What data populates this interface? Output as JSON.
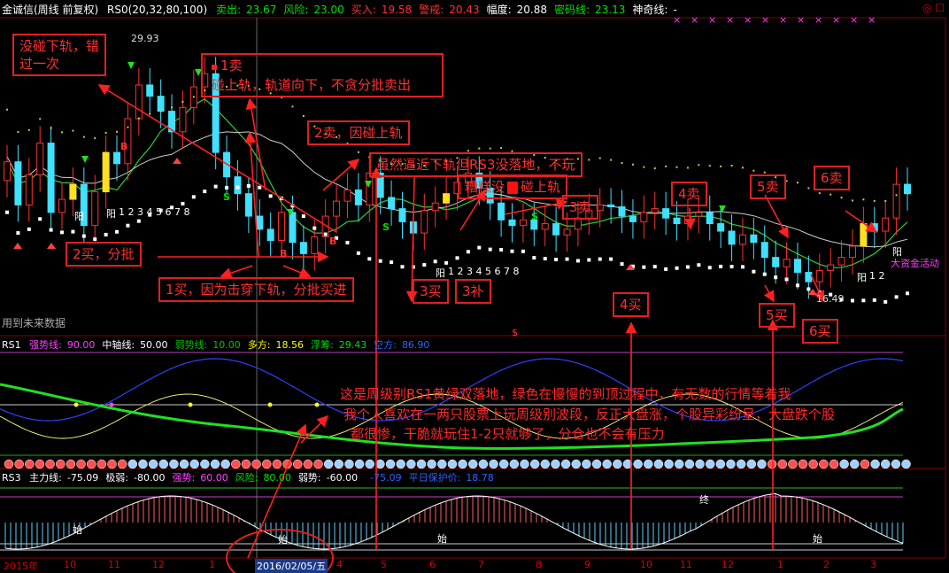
{
  "header": {
    "title": "金诚信(周线 前复权)",
    "rs0_params": "RS0(20,32,80,100)",
    "items": [
      {
        "label": "卖出:",
        "value": "23.67",
        "color": "#00e000"
      },
      {
        "label": "风险:",
        "value": "23.00",
        "color": "#00e000"
      },
      {
        "label": "买入:",
        "value": "19.58",
        "color": "#ff3030"
      },
      {
        "label": "警戒:",
        "value": "20.43",
        "color": "#ff3030"
      },
      {
        "label": "幅度:",
        "value": "20.88",
        "color": "#ffffff"
      },
      {
        "label": "密码线:",
        "value": "23.13",
        "color": "#00e000"
      },
      {
        "label": "神奇线:",
        "value": "-",
        "color": "#ffffff"
      }
    ]
  },
  "main_panel": {
    "future_data_label": "用到未来数据",
    "max_price_label": "29.93",
    "min_price_label": "16.49",
    "mark_yang": "阳",
    "mark_s": "S",
    "mark_b": "B",
    "count_seq": "1 2 3 4 5 6 7 8",
    "count_seq2": "1 2",
    "big_money": "大资金活动",
    "dollar": "$"
  },
  "annotations": {
    "miss": "没碰下轨，错过一次",
    "sell1_a": "1卖",
    "sell1_b": "碰上轨，轨道向下，不贪分批卖出",
    "sell2": "2卖，因碰上轨",
    "no_play": "虽然逼近下轨但RS3没落地，不玩",
    "bad": "糟糕没",
    "bad2": "碰上轨",
    "sell3": "3卖",
    "buy2": "2买，分批",
    "buy1": "1买，因为击穿下轨，分批买进",
    "buy3": "3买",
    "bu3": "3补",
    "sell4": "4卖",
    "sell5": "5卖",
    "sell6": "6卖",
    "buy4": "4买",
    "buy5": "5买",
    "buy6": "6买"
  },
  "rs1": {
    "title": "RS1",
    "items": [
      {
        "label": "强势线:",
        "value": "90.00",
        "color": "#ff40ff"
      },
      {
        "label": "中轴线:",
        "value": "50.00",
        "color": "#ffffff"
      },
      {
        "label": "弱势线:",
        "value": "10.00",
        "color": "#00c000"
      },
      {
        "label": "多方:",
        "value": "18.56",
        "color": "#ffff00"
      },
      {
        "label": "浮筹:",
        "value": "29.43",
        "color": "#00e000"
      },
      {
        "label": "空方:",
        "value": "86.90",
        "color": "#3060ff"
      }
    ],
    "note_line1": "这是周级别RS1黄绿双落地，绿色在慢慢的到顶过程中，有无数的行情等着我",
    "note_line2": "我个人喜欢在一两只股票上玩周级别波段，反正大盘涨，个股异彩纷呈，大盘跌个股",
    "note_line3": "都很惨，干脆就玩住1-2只就够了，分仓也不会有压力"
  },
  "rs3": {
    "title": "RS3",
    "items": [
      {
        "label": "主力线:",
        "value": "-75.09",
        "color": "#ffffff"
      },
      {
        "label": "极弱:",
        "value": "-80.00",
        "color": "#ffffff"
      },
      {
        "label": "强势:",
        "value": "60.00",
        "color": "#ff40ff"
      },
      {
        "label": "风险:",
        "value": "80.00",
        "color": "#00e000"
      },
      {
        "label": "弱势:",
        "value": "-60.00",
        "color": "#ffffff"
      },
      {
        "label": "",
        "value": "-75.09",
        "color": "#3060ff"
      },
      {
        "label": "平日保护价:",
        "value": "18.78",
        "color": "#3060ff"
      }
    ],
    "start_label": "始",
    "end_label": "终"
  },
  "x_axis": {
    "ticks": [
      "2015年",
      "10",
      "11",
      "12",
      "1",
      "2016/02/05/五",
      "4",
      "5",
      "6",
      "7",
      "8",
      "9",
      "10",
      "11",
      "12",
      "1",
      "2",
      "3"
    ]
  },
  "chart_data": {
    "type": "candlestick",
    "series": [
      {
        "name": "price",
        "values": [
          23.5,
          21.2,
          22.8,
          24.5,
          20.8,
          21.5,
          22.3,
          20.1,
          21.9,
          24.0,
          23.4,
          25.8,
          27.6,
          27.0,
          26.2,
          25.1,
          26.4,
          27.5,
          28.2,
          24.0,
          22.7,
          21.8,
          20.6,
          19.9,
          19.3,
          20.8,
          19.2,
          18.6,
          19.5,
          20.6,
          21.4,
          22.0,
          21.2,
          22.9,
          21.6,
          21.0,
          20.3,
          19.7,
          20.9,
          21.3,
          21.8,
          22.4,
          22.9,
          22.1,
          21.3,
          20.4,
          20.1,
          20.4,
          19.9,
          20.2,
          19.6,
          19.9,
          20.5,
          20.9,
          21.2,
          21.1,
          20.6,
          20.3,
          20.8,
          21.0,
          20.5,
          20.2,
          20.6,
          20.8,
          20.2,
          19.8,
          19.1,
          19.6,
          19.2,
          18.4,
          17.9,
          18.3,
          17.6,
          17.1,
          17.7,
          18.0,
          18.4,
          19.0,
          20.2,
          19.8,
          20.5,
          22.3,
          21.8
        ]
      }
    ]
  }
}
